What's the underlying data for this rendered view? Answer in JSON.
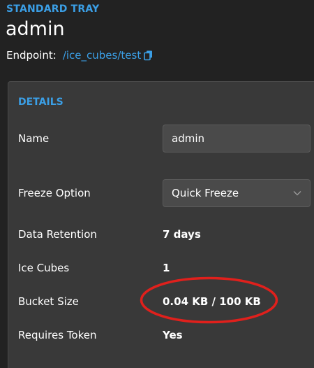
{
  "header": {
    "eyebrow": "STANDARD TRAY",
    "title": "admin",
    "endpoint_label": "Endpoint:",
    "endpoint_value": "/ice_cubes/test",
    "copy_icon": "copy-icon"
  },
  "details": {
    "title": "DETAILS",
    "name_label": "Name",
    "name_value": "admin",
    "freeze_label": "Freeze Option",
    "freeze_value": "Quick Freeze",
    "retention_label": "Data Retention",
    "retention_value": "7 days",
    "ice_cubes_label": "Ice Cubes",
    "ice_cubes_value": "1",
    "bucket_label": "Bucket Size",
    "bucket_value": "0.04 KB / 100 KB",
    "token_label": "Requires Token",
    "token_value": "Yes"
  },
  "colors": {
    "accent": "#3b9fe6",
    "annotation": "#e0201c",
    "background": "#222222",
    "card": "#393939"
  }
}
